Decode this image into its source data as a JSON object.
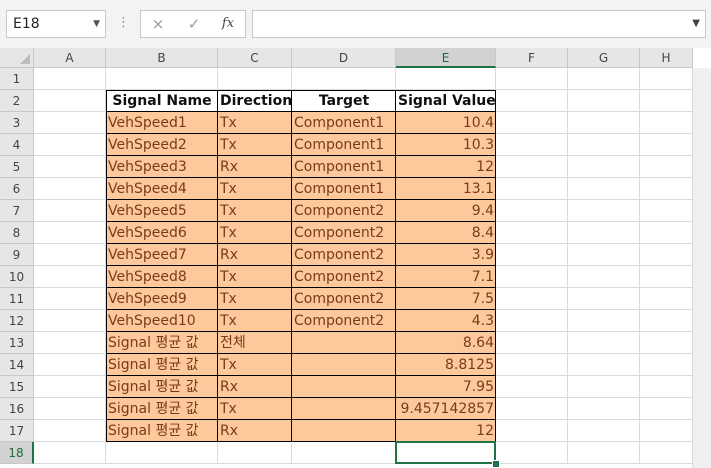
{
  "formula_bar": {
    "name_box": "E18",
    "cancel_icon": "×",
    "enter_icon": "✓",
    "fx_label": "fx",
    "formula": ""
  },
  "sheet": {
    "columns": [
      "A",
      "B",
      "C",
      "D",
      "E",
      "F",
      "G",
      "H"
    ],
    "rows": [
      "1",
      "2",
      "3",
      "4",
      "5",
      "6",
      "7",
      "8",
      "9",
      "10",
      "11",
      "12",
      "13",
      "14",
      "15",
      "16",
      "17",
      "18"
    ],
    "selected_cell": "E18",
    "table": {
      "headers": [
        "Signal Name",
        "Direction",
        "Target",
        "Signal Value"
      ],
      "rows": [
        [
          "VehSpeed1",
          "Tx",
          "Component1",
          "10.4"
        ],
        [
          "VehSpeed2",
          "Tx",
          "Component1",
          "10.3"
        ],
        [
          "VehSpeed3",
          "Rx",
          "Component1",
          "12"
        ],
        [
          "VehSpeed4",
          "Tx",
          "Component1",
          "13.1"
        ],
        [
          "VehSpeed5",
          "Tx",
          "Component2",
          "9.4"
        ],
        [
          "VehSpeed6",
          "Tx",
          "Component2",
          "8.4"
        ],
        [
          "VehSpeed7",
          "Rx",
          "Component2",
          "3.9"
        ],
        [
          "VehSpeed8",
          "Tx",
          "Component2",
          "7.1"
        ],
        [
          "VehSpeed9",
          "Tx",
          "Component2",
          "7.5"
        ],
        [
          "VehSpeed10",
          "Tx",
          "Component2",
          "4.3"
        ],
        [
          "Signal 평균 값",
          "전체",
          "",
          "8.64"
        ],
        [
          "Signal 평균 값",
          "Tx",
          "",
          "8.8125"
        ],
        [
          "Signal 평균 값",
          "Rx",
          "",
          "7.95"
        ],
        [
          "Signal 평균 값",
          "Tx",
          "",
          "9.457142857"
        ],
        [
          "Signal 평균 값",
          "Rx",
          "",
          "12"
        ]
      ]
    }
  },
  "colors": {
    "accent": "#217346",
    "cell_fill": "#fdc99c",
    "cell_text": "#7a3b17"
  }
}
